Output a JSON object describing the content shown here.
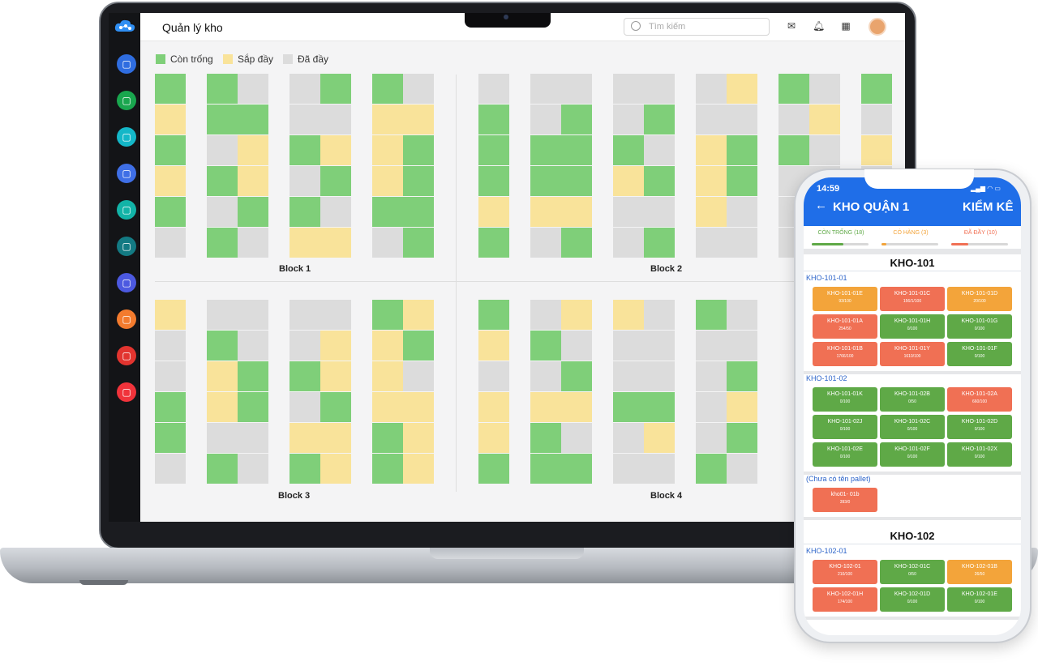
{
  "app": {
    "title": "Quản lý kho",
    "search_placeholder": "Tìm kiếm",
    "sidebar_icons": [
      "dashboard-icon",
      "laptop-icon",
      "users-icon",
      "box-icon",
      "scan-icon",
      "contact-icon",
      "warehouse-icon",
      "report-icon",
      "building-icon",
      "settings-icon"
    ],
    "sidebar_colors": [
      "#2f6de0",
      "#19a64e",
      "#14b7c8",
      "#3f6fe6",
      "#12b3a7",
      "#137a83",
      "#4c59e0",
      "#f37b2e",
      "#e2342f",
      "#f0333b"
    ],
    "header_icons": [
      "mail-icon",
      "bell-icon",
      "calendar-icon"
    ]
  },
  "legend": [
    {
      "label": "Còn trống",
      "color": "#7fcf79"
    },
    {
      "label": "Sắp đầy",
      "color": "#f9e39a"
    },
    {
      "label": "Đã đầy",
      "color": "#dcdcdc"
    }
  ],
  "blocks": [
    {
      "label": "Block 1",
      "columns": [
        [
          "g",
          "y",
          "g",
          "y",
          "g",
          "e"
        ],
        [
          "g",
          "g",
          "e",
          "g",
          "e",
          "g"
        ],
        [
          "e",
          "g",
          "y",
          "y",
          "g",
          "e"
        ],
        [
          "e",
          "e",
          "g",
          "e",
          "g",
          "y"
        ],
        [
          "g",
          "e",
          "y",
          "g",
          "e",
          "y"
        ],
        [
          "g",
          "y",
          "y",
          "y",
          "g",
          "e"
        ],
        [
          "e",
          "y",
          "g",
          "g",
          "g",
          "g"
        ]
      ]
    },
    {
      "label": "Block 2",
      "columns": [
        [
          "e",
          "g",
          "g",
          "g",
          "y",
          "g"
        ],
        [
          "e",
          "e",
          "g",
          "g",
          "y",
          "e"
        ],
        [
          "e",
          "g",
          "g",
          "g",
          "y",
          "g"
        ],
        [
          "e",
          "e",
          "g",
          "y",
          "e",
          "e"
        ],
        [
          "e",
          "g",
          "e",
          "g",
          "e",
          "g"
        ],
        [
          "e",
          "e",
          "y",
          "y",
          "y",
          "e"
        ],
        [
          "y",
          "e",
          "g",
          "g",
          "e",
          "e"
        ],
        [
          "g",
          "e",
          "g",
          "e",
          "e",
          "e"
        ],
        [
          "e",
          "y",
          "e",
          "e",
          "e",
          "e"
        ],
        [
          "g",
          "e",
          "y",
          "e",
          "e",
          "y"
        ]
      ]
    },
    {
      "label": "Block 3",
      "columns": [
        [
          "y",
          "e",
          "e",
          "g",
          "g",
          "e"
        ],
        [
          "e",
          "g",
          "y",
          "y",
          "e",
          "g"
        ],
        [
          "e",
          "e",
          "g",
          "g",
          "e",
          "e"
        ],
        [
          "e",
          "e",
          "g",
          "e",
          "y",
          "g"
        ],
        [
          "e",
          "y",
          "y",
          "g",
          "y",
          "y"
        ],
        [
          "g",
          "y",
          "y",
          "y",
          "g",
          "g"
        ],
        [
          "y",
          "g",
          "e",
          "y",
          "y",
          "y"
        ]
      ]
    },
    {
      "label": "Block 4",
      "columns": [
        [
          "g",
          "y",
          "e",
          "y",
          "y",
          "g"
        ],
        [
          "e",
          "g",
          "e",
          "y",
          "g",
          "g"
        ],
        [
          "y",
          "e",
          "g",
          "y",
          "e",
          "g"
        ],
        [
          "y",
          "e",
          "e",
          "g",
          "e",
          "e"
        ],
        [
          "e",
          "e",
          "e",
          "g",
          "y",
          "e"
        ],
        [
          "g",
          "e",
          "e",
          "e",
          "e",
          "g"
        ],
        [
          "e",
          "e",
          "g",
          "y",
          "g",
          "e"
        ]
      ]
    }
  ],
  "phone": {
    "time": "14:59",
    "status": "▂▄▆ ◠ ▭",
    "back": "←",
    "title": "KHO QUẬN 1",
    "action": "KIỂM KÊ",
    "tabs": [
      {
        "label": "CÒN TRỐNG (18)",
        "color": "#5fa947",
        "progress": 0.55
      },
      {
        "label": "CÓ HÀNG (3)",
        "color": "#f3a43a",
        "progress": 0.08
      },
      {
        "label": "ĐÃ ĐẦY (10)",
        "color": "#f07054",
        "progress": 0.3
      }
    ],
    "warehouses": [
      {
        "name": "KHO-101",
        "groups": [
          {
            "name": "KHO-101-01",
            "pallets": [
              {
                "code": "KHO-101-01E",
                "count": "93/100",
                "status": "y"
              },
              {
                "code": "KHO-101-01C",
                "count": "156/1/100",
                "status": "o"
              },
              {
                "code": "KHO-101-01D",
                "count": "20/100",
                "status": "y"
              },
              {
                "code": "KHO-101-01A",
                "count": "254/50",
                "status": "o"
              },
              {
                "code": "KHO-101-01H",
                "count": "0/100",
                "status": "g"
              },
              {
                "code": "KHO-101-01G",
                "count": "0/100",
                "status": "g"
              },
              {
                "code": "KHO-101-01B",
                "count": "1766/100",
                "status": "o"
              },
              {
                "code": "KHO-101-01Y",
                "count": "1610/100",
                "status": "o"
              },
              {
                "code": "KHO-101-01F",
                "count": "0/100",
                "status": "g"
              }
            ]
          },
          {
            "name": "KHO-101-02",
            "pallets": [
              {
                "code": "KHO-101-01K",
                "count": "0/100",
                "status": "g"
              },
              {
                "code": "KHO-101-02B",
                "count": "0/50",
                "status": "g"
              },
              {
                "code": "KHO-101-02A",
                "count": "660/100",
                "status": "o"
              },
              {
                "code": "KHO-101-02J",
                "count": "0/100",
                "status": "g"
              },
              {
                "code": "KHO-101-02C",
                "count": "0/100",
                "status": "g"
              },
              {
                "code": "KHO-101-02D",
                "count": "0/100",
                "status": "g"
              },
              {
                "code": "KHO-101-02E",
                "count": "0/100",
                "status": "g"
              },
              {
                "code": "KHO-101-02F",
                "count": "0/100",
                "status": "g"
              },
              {
                "code": "KHO-101-02X",
                "count": "0/100",
                "status": "g"
              }
            ]
          },
          {
            "name": "(Chưa có tên pallet)",
            "pallets": [
              {
                "code": "kho01- 01b",
                "count": "393/0",
                "status": "o"
              }
            ]
          }
        ]
      },
      {
        "name": "KHO-102",
        "groups": [
          {
            "name": "KHO-102-01",
            "pallets": [
              {
                "code": "KHO-102-01",
                "count": "210/100",
                "status": "o"
              },
              {
                "code": "KHO-102-01C",
                "count": "0/50",
                "status": "g"
              },
              {
                "code": "KHO-102-01B",
                "count": "26/50",
                "status": "y"
              },
              {
                "code": "KHO-102-01H",
                "count": "174/100",
                "status": "o"
              },
              {
                "code": "KHO-102-01D",
                "count": "0/100",
                "status": "g"
              },
              {
                "code": "KHO-102-01E",
                "count": "0/100",
                "status": "g"
              }
            ]
          }
        ]
      }
    ]
  }
}
